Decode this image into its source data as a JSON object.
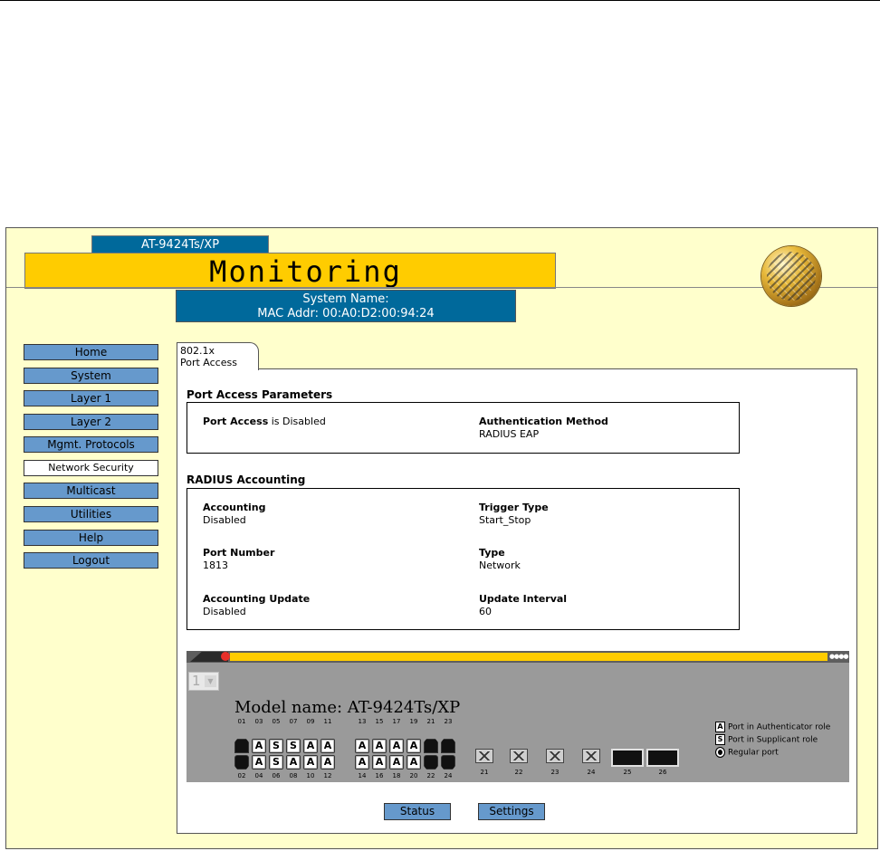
{
  "header": {
    "model": "AT-9424Ts/XP",
    "title": "Monitoring",
    "system_name": "System Name:",
    "mac_addr": "MAC Addr: 00:A0:D2:00:94:24"
  },
  "nav": [
    {
      "label": "Home",
      "active": false
    },
    {
      "label": "System",
      "active": false
    },
    {
      "label": "Layer 1",
      "active": false
    },
    {
      "label": "Layer 2",
      "active": false
    },
    {
      "label": "Mgmt. Protocols",
      "active": false
    },
    {
      "label": "Network Security",
      "active": true
    },
    {
      "label": "Multicast",
      "active": false
    },
    {
      "label": "Utilities",
      "active": false
    },
    {
      "label": "Help",
      "active": false
    },
    {
      "label": "Logout",
      "active": false
    }
  ],
  "tab": {
    "line1": "802.1x",
    "line2": "Port Access"
  },
  "port_access": {
    "title": "Port Access Parameters",
    "status_label": "Port Access",
    "status_value": "is Disabled",
    "auth_method_label": "Authentication Method",
    "auth_method_value": "RADIUS EAP"
  },
  "radius": {
    "title": "RADIUS Accounting",
    "accounting_label": "Accounting",
    "accounting_value": "Disabled",
    "trigger_label": "Trigger Type",
    "trigger_value": "Start_Stop",
    "port_label": "Port Number",
    "port_value": "1813",
    "type_label": "Type",
    "type_value": "Network",
    "update_label": "Accounting Update",
    "update_value": "Disabled",
    "interval_label": "Update Interval",
    "interval_value": "60"
  },
  "switch": {
    "unit": "1",
    "model_name": "Model name: AT-9424Ts/XP",
    "top_ports": [
      "01",
      "03",
      "05",
      "07",
      "09",
      "11",
      "13",
      "15",
      "17",
      "19",
      "21",
      "23"
    ],
    "bottom_ports": [
      "02",
      "04",
      "06",
      "08",
      "10",
      "12",
      "14",
      "16",
      "18",
      "20",
      "22",
      "24"
    ],
    "top_roles": [
      "R",
      "A",
      "S",
      "S",
      "A",
      "A",
      "A",
      "A",
      "A",
      "A",
      "R",
      "R"
    ],
    "bottom_roles": [
      "R",
      "A",
      "S",
      "A",
      "A",
      "A",
      "A",
      "A",
      "A",
      "A",
      "R",
      "R"
    ],
    "role_letters": {
      "A": "A",
      "S": "S"
    },
    "gbic_ports": [
      "21",
      "22",
      "23",
      "24"
    ],
    "sfp_ports": [
      "25",
      "26"
    ],
    "legend": [
      {
        "icon": "A",
        "label": "Port in Authenticator role"
      },
      {
        "icon": "S",
        "label": "Port in Supplicant role"
      },
      {
        "icon": "",
        "label": "Regular port"
      }
    ]
  },
  "actions": {
    "status": "Status",
    "settings": "Settings"
  }
}
